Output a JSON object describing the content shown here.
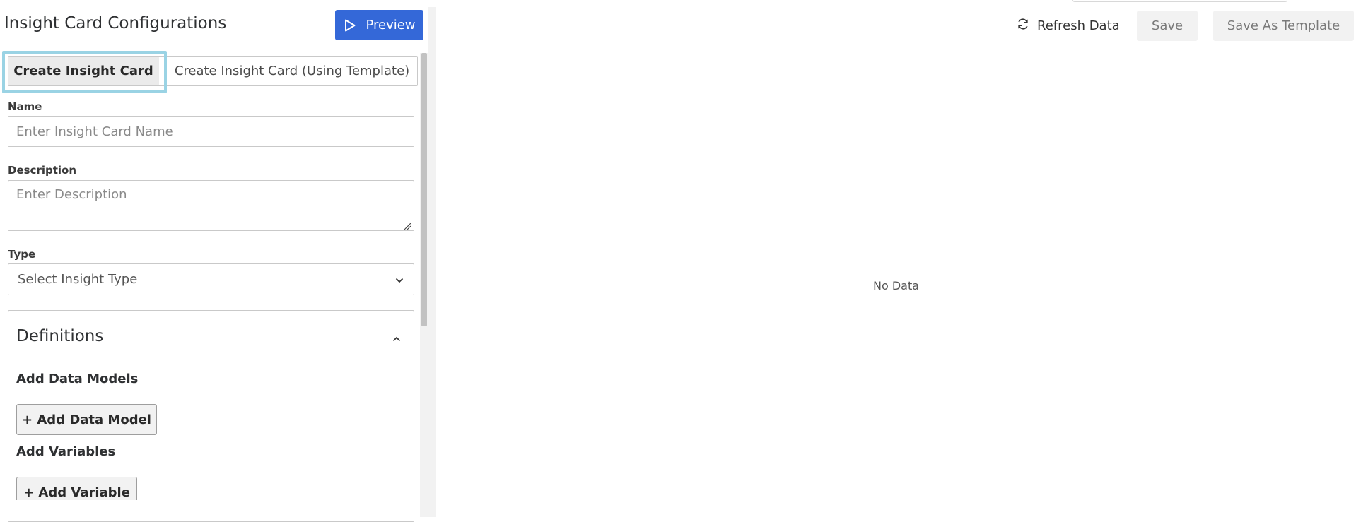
{
  "config_panel": {
    "title": "Insight Card Configurations",
    "preview_label": "Preview",
    "tabs": [
      {
        "label": "Create Insight Card",
        "active": true
      },
      {
        "label": "Create Insight Card (Using Template)",
        "active": false
      }
    ],
    "name_field": {
      "label": "Name",
      "value": "",
      "placeholder": "Enter Insight Card Name"
    },
    "description_field": {
      "label": "Description",
      "value": "",
      "placeholder": "Enter Description"
    },
    "type_field": {
      "label": "Type",
      "selected": "Select Insight Type"
    },
    "definitions": {
      "title": "Definitions",
      "expanded": true,
      "data_models_heading": "Add Data Models",
      "add_data_model_label": "+ Add Data Model",
      "variables_heading": "Add Variables",
      "add_variable_label": "+ Add Variable"
    }
  },
  "preview_panel": {
    "refresh_label": "Refresh Data",
    "save_label": "Save",
    "save_template_label": "Save As Template",
    "empty_text": "No Data"
  },
  "colors": {
    "primary": "#3468d8",
    "active_tab_outline": "#9ad3e4",
    "border": "#c9c9c9",
    "muted_button_bg": "#f2f2f2"
  },
  "icons": {
    "preview": "play-icon",
    "refresh": "refresh-icon",
    "type_select": "chevron-down-icon",
    "definitions_toggle": "chevron-up-icon",
    "textarea_resize": "resize-grip-icon"
  }
}
